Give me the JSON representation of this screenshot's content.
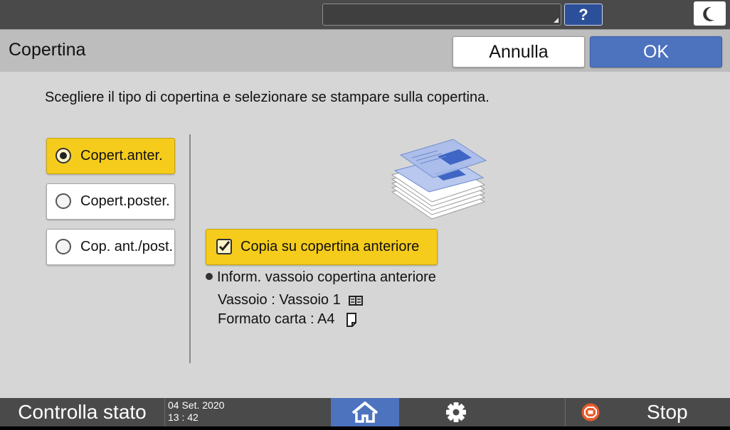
{
  "topbar": {
    "help_label": "?"
  },
  "header": {
    "title": "Copertina",
    "cancel_label": "Annulla",
    "ok_label": "OK"
  },
  "instruction": "Scegliere il tipo di copertina e selezionare se stampare sulla copertina.",
  "options": [
    {
      "label": "Copert.anter.",
      "selected": true
    },
    {
      "label": "Copert.poster.",
      "selected": false
    },
    {
      "label": "Cop. ant./post.",
      "selected": false
    }
  ],
  "copy_checkbox": {
    "label": "Copia su copertina anteriore",
    "checked": true
  },
  "tray_info": {
    "heading": "Inform. vassoio copertina anteriore",
    "tray_line": "Vassoio : Vassoio 1",
    "format_line": "Formato carta : A4"
  },
  "bottombar": {
    "status_label": "Controlla stato",
    "date": "04 Set. 2020",
    "time": "13 : 42",
    "stop_label": "Stop"
  },
  "colors": {
    "accent_blue": "#4d73bf",
    "selected_yellow": "#f6cc1c",
    "bar_dark": "#4a4a4a",
    "panel_gray": "#d6d6d6"
  },
  "icons": {
    "help": "question-icon",
    "night": "moon-icon",
    "home": "home-icon",
    "settings": "gear-icon",
    "stop": "stop-icon",
    "tray": "tray-icon",
    "paper": "paper-portrait-icon"
  }
}
